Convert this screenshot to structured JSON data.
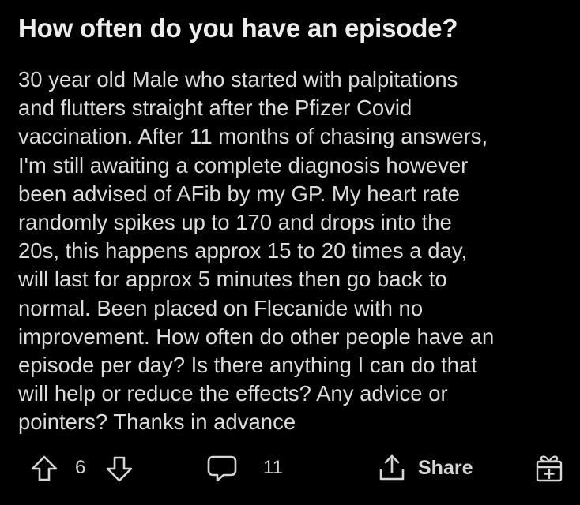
{
  "post": {
    "title": "How often do you have an episode?",
    "body_lines": [
      "30 year old Male who started with palpitations",
      "and flutters straight after the Pfizer Covid",
      "vaccination. After 11 months of chasing answers,",
      "I'm still awaiting a complete diagnosis however",
      "been advised of AFib by my GP. My heart rate",
      "randomly spikes up to 170 and drops into the",
      "20s, this happens approx 15 to 20 times a day,",
      "will last for approx 5 minutes then go back to",
      "normal. Been placed on Flecanide with no",
      "improvement. How often do other people have an",
      "episode per day? Is there anything I can do that",
      "will help or reduce the effects? Any advice or",
      "pointers? Thanks in advance"
    ]
  },
  "actions": {
    "vote_count": "6",
    "comment_count": "11",
    "share_label": "Share",
    "icons": {
      "upvote": "arrow-up-outline-icon",
      "downvote": "arrow-down-outline-icon",
      "comment": "speech-bubble-icon",
      "share": "share-arrow-icon",
      "award": "gift-icon"
    }
  },
  "colors": {
    "background": "#000000",
    "text": "#dcdcdc"
  }
}
